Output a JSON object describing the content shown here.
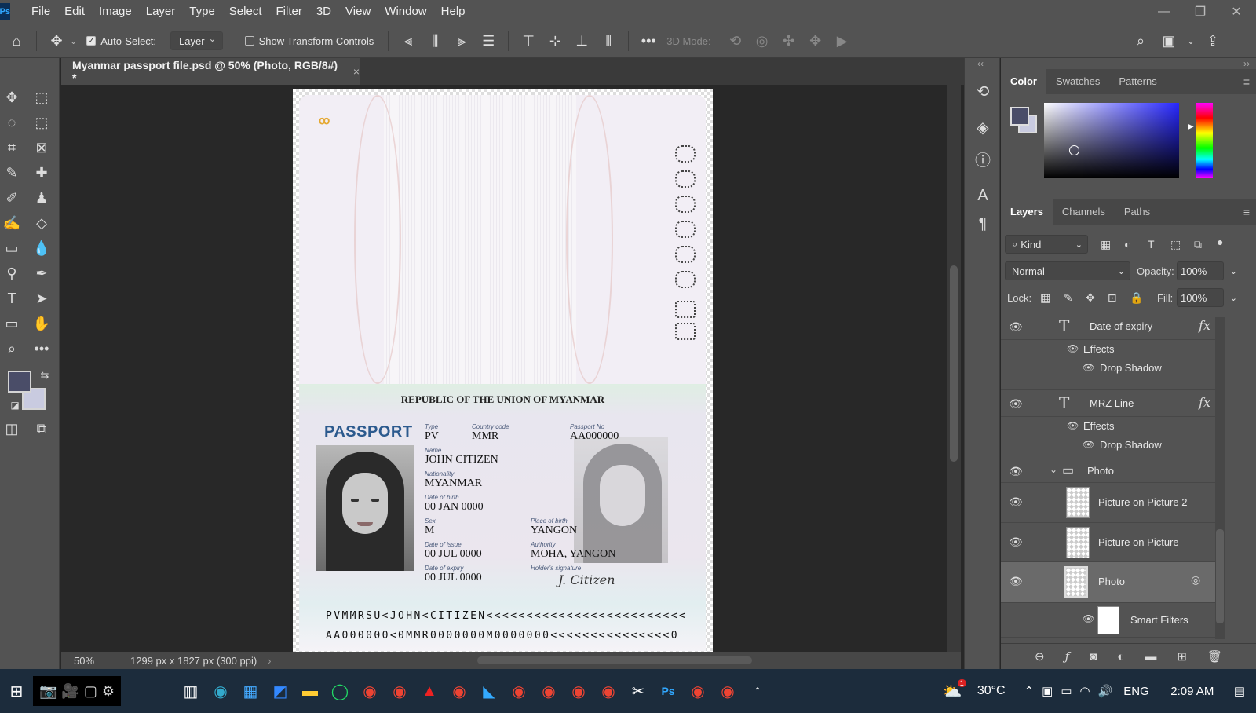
{
  "menubar": {
    "logo": "Ps",
    "items": [
      "File",
      "Edit",
      "Image",
      "Layer",
      "Type",
      "Select",
      "Filter",
      "3D",
      "View",
      "Window",
      "Help"
    ],
    "window_controls": [
      "—",
      "❐",
      "✕"
    ]
  },
  "options": {
    "auto_select_label": "Auto-Select:",
    "auto_select_value": "Layer",
    "show_transform_label": "Show Transform Controls",
    "mode_3d_label": "3D Mode:",
    "more": "•••"
  },
  "document": {
    "tab_title": "Myanmar passport file.psd @ 50% (Photo, RGB/8#) *",
    "tab_close": "×",
    "zoom": "50%",
    "dimensions": "1299 px x 1827 px (300 ppi)"
  },
  "passport": {
    "republic": "REPUBLIC OF THE UNION OF MYANMAR",
    "title": "PASSPORT",
    "type_label": "Type",
    "type_value": "PV",
    "country_label": "Country code",
    "country_value": "MMR",
    "number_label": "Passport No",
    "number_value": "AA000000",
    "name_label": "Name",
    "name_value": "JOHN CITIZEN",
    "nationality_label": "Nationality",
    "nationality_value": "MYANMAR",
    "dob_label": "Date of birth",
    "dob_value": "00 JAN 0000",
    "sex_label": "Sex",
    "sex_value": "M",
    "pob_label": "Place of birth",
    "pob_value": "YANGON",
    "doi_label": "Date of issue",
    "doi_value": "00 JUL 0000",
    "authority_label": "Authority",
    "authority_value": "MOHA, YANGON",
    "doe_label": "Date of expiry",
    "doe_value": "00 JUL 0000",
    "signature_label": "Holder's signature",
    "signature_value": "J. Citizen",
    "mrz_line1": "PVMMRSU<JOHN<CITIZEN<<<<<<<<<<<<<<<<<<<<<<<<<",
    "mrz_line2": "AA000000<0MMR0000000M0000000<<<<<<<<<<<<<<<0"
  },
  "color_panel": {
    "tabs": [
      "Color",
      "Swatches",
      "Patterns"
    ],
    "fg_color": "#4a4d68",
    "bg_color": "#c9cbe0"
  },
  "layers_panel": {
    "tabs": [
      "Layers",
      "Channels",
      "Paths"
    ],
    "filter_kind": "Kind",
    "blend_mode": "Normal",
    "opacity_label": "Opacity:",
    "opacity_value": "100%",
    "lock_label": "Lock:",
    "fill_label": "Fill:",
    "fill_value": "100%",
    "layers": {
      "date_of_expiry": "Date of expiry",
      "effects_1": "Effects",
      "drop_shadow_1": "Drop Shadow",
      "mrz_line": "MRZ Line",
      "effects_2": "Effects",
      "drop_shadow_2": "Drop Shadow",
      "photo_group": "Photo",
      "picture_on_picture_2": "Picture on Picture 2",
      "picture_on_picture": "Picture on Picture",
      "photo_layer": "Photo",
      "smart_filters": "Smart Filters"
    },
    "fx": "fx"
  },
  "taskbar": {
    "temperature": "30°C",
    "language": "ENG",
    "time": "2:09 AM",
    "notification_count": "1"
  }
}
